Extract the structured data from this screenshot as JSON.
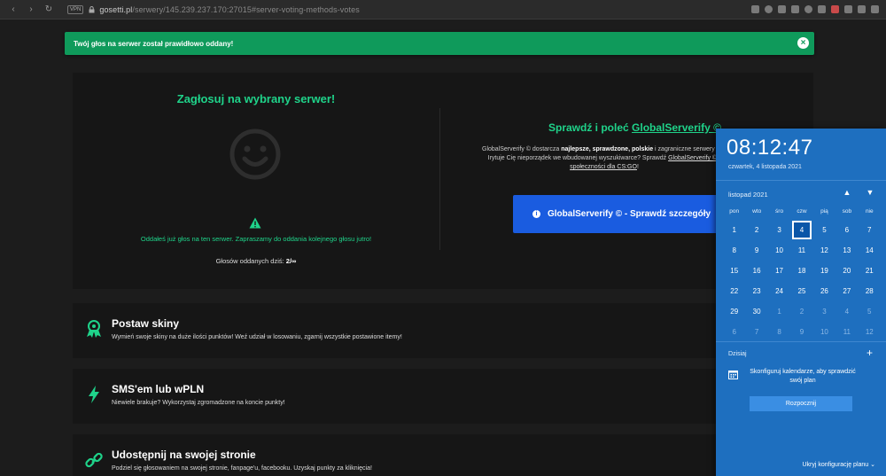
{
  "browser": {
    "vpn": "VPN",
    "url_host": "gosetti.pl",
    "url_path": "/serwery/145.239.237.170:27015#server-voting-methods-votes"
  },
  "alert": {
    "message": "Twój głos na serwer został prawidłowo oddany!",
    "close": "×"
  },
  "vote": {
    "title": "Zagłosuj na wybrany serwer!",
    "message": "Oddałeś już głos na ten serwer. Zapraszamy do oddania kolejnego głosu jutro!",
    "count_label": "Głosów oddanych dziś:",
    "count_value": "2/∞"
  },
  "globalserverify": {
    "title_prefix": "Sprawdź i poleć",
    "title_link": "GlobalServerify ©",
    "desc_1": "GlobalServerify © dostarcza",
    "desc_bold": "najlepsze, sprawdzone, polskie",
    "desc_2": "i zagraniczne serwery bez",
    "desc_3": "Irytuje Cię nieporządek we wbudowanej wyszukiwarce? Sprawdź",
    "desc_link": "GlobalServerify © -",
    "desc_link2": "społeczności dla CS:GO",
    "desc_end": "!",
    "button": "GlobalServerify © - Sprawdź szczegóły",
    "button_icon": "i"
  },
  "features": [
    {
      "title": "Postaw skiny",
      "desc": "Wymień swoje skiny na duże ilości punktów! Weź udział w losowaniu, zgarnij wszystkie postawione itemy!"
    },
    {
      "title": "SMS'em lub wPLN",
      "desc": "Niewiele brakuje? Wykorzystaj zgromadzone na koncie punkty!"
    },
    {
      "title": "Udostępnij na swojej stronie",
      "desc": "Podziel się głosowaniem na swojej stronie, fanpage'u, facebooku. Uzyskaj punkty za kliknięcia!"
    }
  ],
  "calendar": {
    "time": "08:12:47",
    "date": "czwartek, 4 listopada 2021",
    "month": "listopad 2021",
    "up": "▲",
    "down": "▼",
    "weekdays": [
      "pon",
      "wto",
      "śro",
      "czw",
      "pią",
      "sob",
      "nie"
    ],
    "days": [
      [
        1,
        2,
        3,
        4,
        5,
        6,
        7
      ],
      [
        8,
        9,
        10,
        11,
        12,
        13,
        14
      ],
      [
        15,
        16,
        17,
        18,
        19,
        20,
        21
      ],
      [
        22,
        23,
        24,
        25,
        26,
        27,
        28
      ],
      [
        29,
        30,
        1,
        2,
        3,
        4,
        5
      ],
      [
        6,
        7,
        8,
        9,
        10,
        11,
        12
      ]
    ],
    "today": 4,
    "agenda_label": "Dzisiaj",
    "plus": "+",
    "agenda_text": "Skonfiguruj kalendarze, aby sprawdzić swój plan",
    "start_button": "Rozpocznij",
    "hide_plan": "Ukryj konfigurację planu ⌄"
  },
  "colors": {
    "accent_green": "#1fd38a",
    "alert_green": "#0f9a5b",
    "button_blue": "#1a5ce0",
    "calendar_blue": "#1e6fbf"
  }
}
